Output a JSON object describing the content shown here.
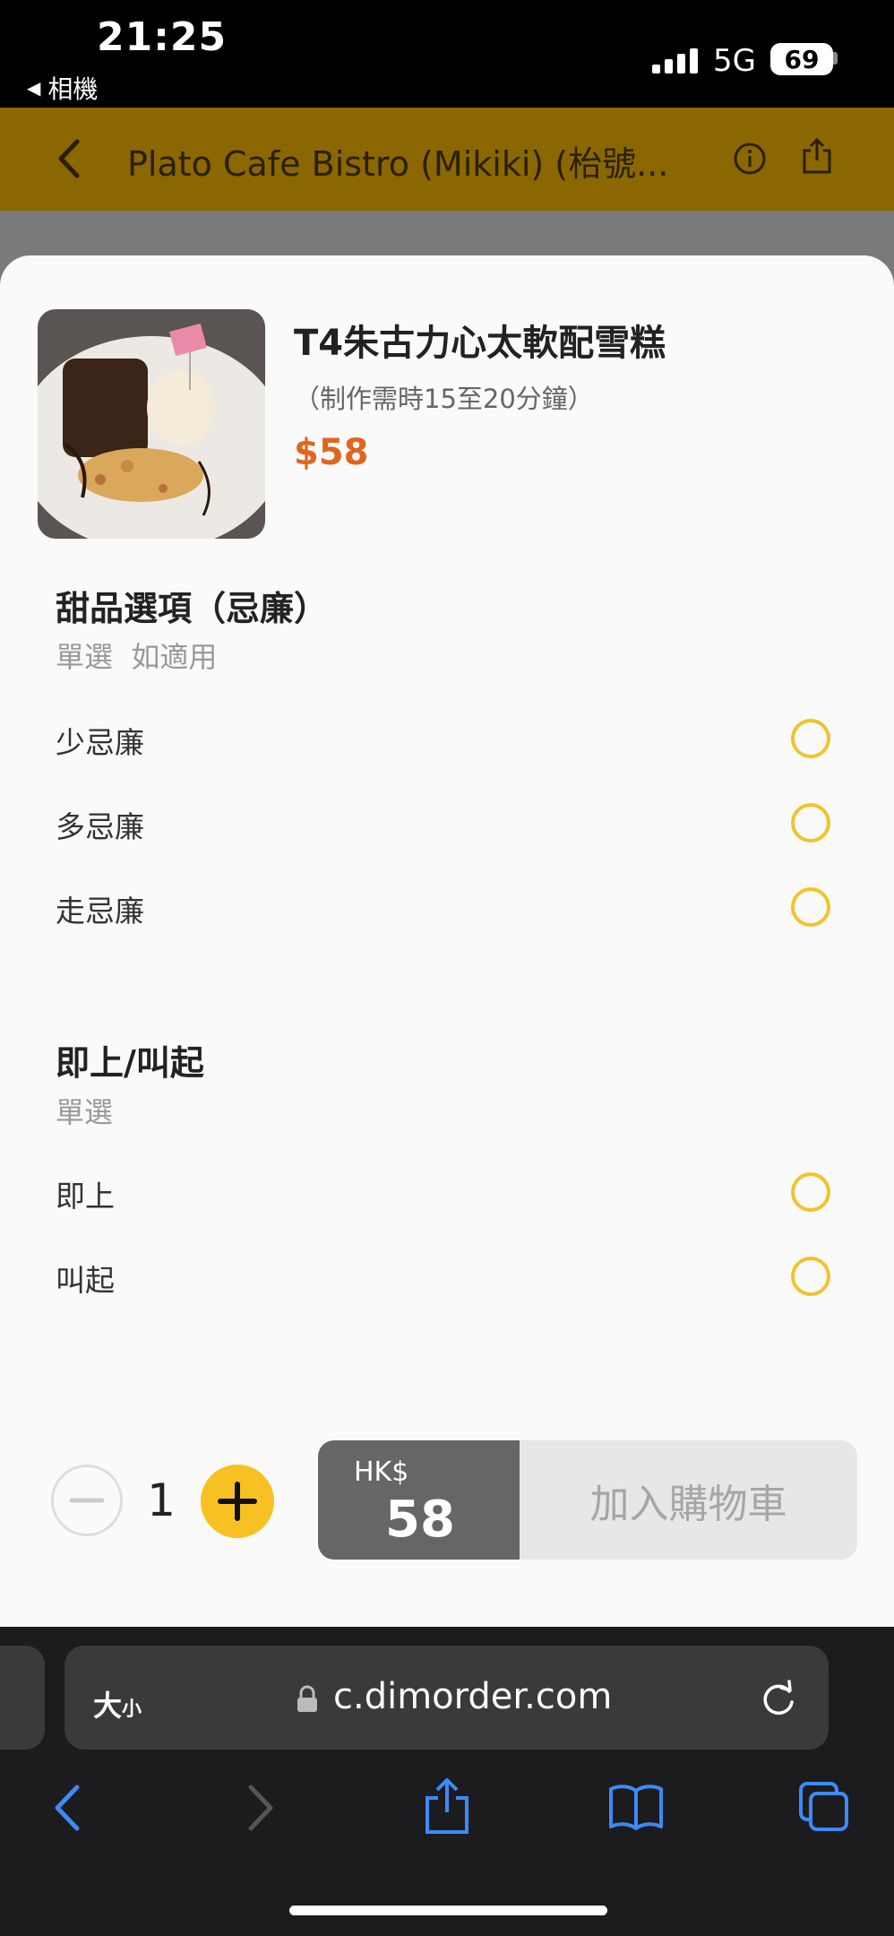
{
  "status": {
    "time": "21:25",
    "back_app": "相機",
    "network": "5G",
    "battery": "69"
  },
  "header": {
    "title": "Plato Cafe Bistro (Mikiki) (枱號..."
  },
  "item": {
    "name": "T4朱古力心太軟配雪糕",
    "note": "（制作需時15至20分鐘）",
    "price": "$58"
  },
  "groups": [
    {
      "title": "甜品選項（忌廉）",
      "sub": "單選  如適用",
      "options": [
        "少忌廉",
        "多忌廉",
        "走忌廉"
      ]
    },
    {
      "title": "即上/叫起",
      "sub": "單選",
      "options": [
        "即上",
        "叫起"
      ]
    }
  ],
  "cart": {
    "quantity": "1",
    "currency": "HK$",
    "total": "58",
    "add_label": "加入購物車"
  },
  "browser": {
    "text_size_big": "大",
    "text_size_small": "小",
    "url": "c.dimorder.com"
  },
  "colors": {
    "accent": "#f7c221",
    "price": "#e0661f",
    "radio": "#f2c32a",
    "browser_blue": "#3d8af7"
  },
  "icons": [
    "back-arrow-icon",
    "info-icon",
    "share-icon",
    "lock-icon",
    "reload-icon",
    "minus-icon",
    "plus-icon",
    "forward-arrow-icon",
    "bookmarks-icon",
    "tabs-icon"
  ]
}
